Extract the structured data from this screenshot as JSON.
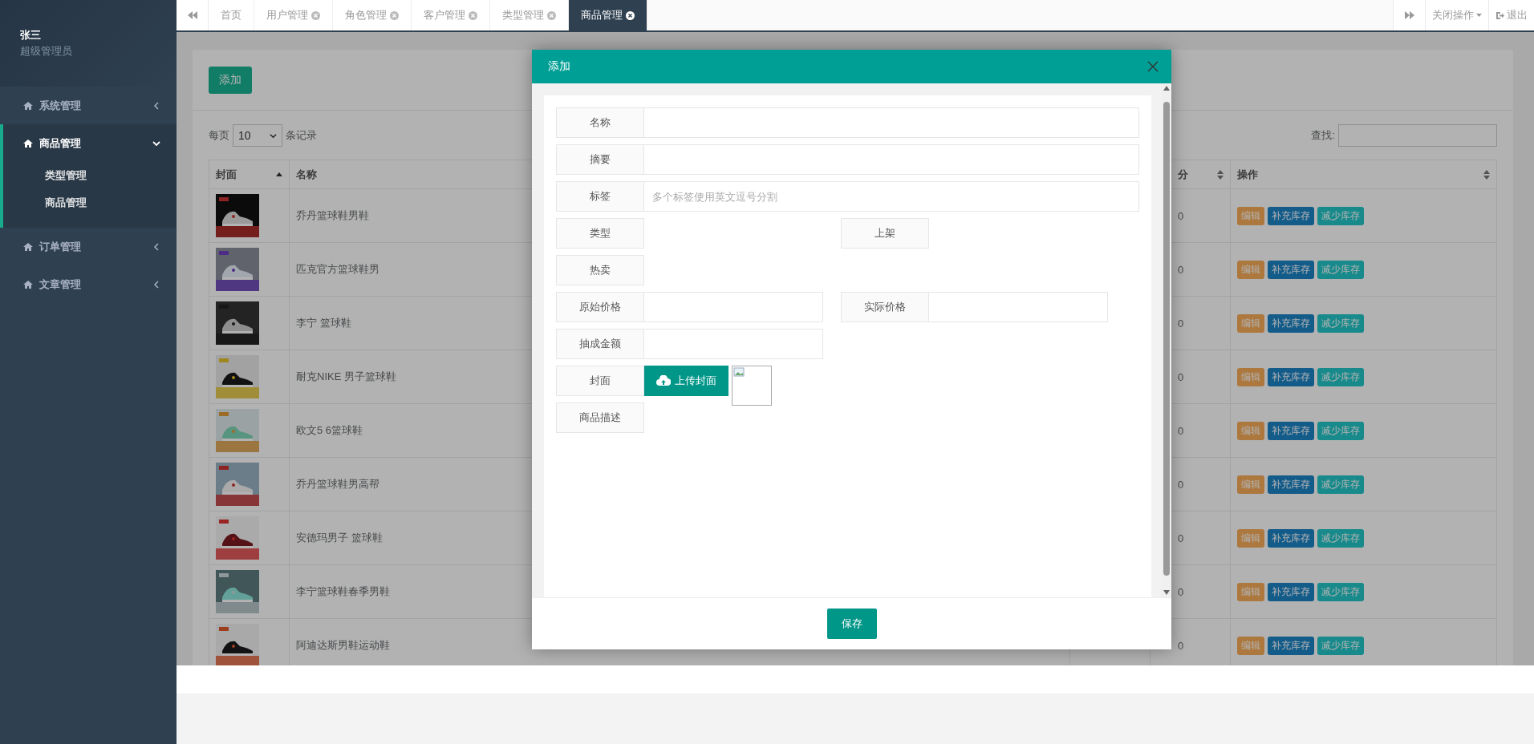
{
  "profile": {
    "name": "张三",
    "role": "超级管理员"
  },
  "sidebar": {
    "items": [
      {
        "label": "系统管理",
        "expanded": false
      },
      {
        "label": "商品管理",
        "expanded": true,
        "children": [
          {
            "label": "类型管理"
          },
          {
            "label": "商品管理"
          }
        ]
      },
      {
        "label": "订单管理",
        "expanded": false
      },
      {
        "label": "文章管理",
        "expanded": false
      }
    ]
  },
  "tabs": [
    {
      "label": "首页",
      "closable": false,
      "selected": false
    },
    {
      "label": "用户管理",
      "closable": true,
      "selected": false
    },
    {
      "label": "角色管理",
      "closable": true,
      "selected": false
    },
    {
      "label": "客户管理",
      "closable": true,
      "selected": false
    },
    {
      "label": "类型管理",
      "closable": true,
      "selected": false
    },
    {
      "label": "商品管理",
      "closable": true,
      "selected": true
    }
  ],
  "tab_actions": {
    "close_menu": "关闭操作",
    "logout": "退出"
  },
  "toolbar": {
    "add_button": "添加"
  },
  "table_controls": {
    "per_page_prefix": "每页",
    "per_page_value": "10",
    "per_page_suffix": "条记录",
    "search_label": "查找:"
  },
  "table": {
    "columns": [
      {
        "label": "封面",
        "kind": "sorted"
      },
      {
        "label": "名称",
        "kind": "plain"
      },
      {
        "label": "分",
        "kind": "sortable"
      },
      {
        "label": "操作",
        "kind": "sortable"
      }
    ],
    "rows": [
      {
        "cover": {
          "kind": "picture"
        },
        "name": "乔丹篮球鞋男鞋",
        "score": "0",
        "actions": [
          {
            "label": "编辑",
            "kind": "edit"
          },
          {
            "label": "补充库存",
            "kind": "add"
          },
          {
            "label": "减少库存",
            "kind": "reduce"
          }
        ]
      },
      {
        "cover": {
          "kind": "picture"
        },
        "name": "匹克官方篮球鞋男",
        "score": "0",
        "actions": [
          {
            "label": "编辑",
            "kind": "edit"
          },
          {
            "label": "补充库存",
            "kind": "add"
          },
          {
            "label": "减少库存",
            "kind": "reduce"
          }
        ]
      },
      {
        "cover": {
          "kind": "picture"
        },
        "name": "李宁 篮球鞋",
        "score": "0",
        "actions": [
          {
            "label": "编辑",
            "kind": "edit"
          },
          {
            "label": "补充库存",
            "kind": "add"
          },
          {
            "label": "减少库存",
            "kind": "reduce"
          }
        ]
      },
      {
        "cover": {
          "kind": "picture"
        },
        "name": "耐克NIKE 男子篮球鞋",
        "score": "0",
        "actions": [
          {
            "label": "编辑",
            "kind": "edit"
          },
          {
            "label": "补充库存",
            "kind": "add"
          },
          {
            "label": "减少库存",
            "kind": "reduce"
          }
        ]
      },
      {
        "cover": {
          "kind": "picture"
        },
        "name": "欧文5 6篮球鞋",
        "score": "0",
        "actions": [
          {
            "label": "编辑",
            "kind": "edit"
          },
          {
            "label": "补充库存",
            "kind": "add"
          },
          {
            "label": "减少库存",
            "kind": "reduce"
          }
        ]
      },
      {
        "cover": {
          "kind": "picture"
        },
        "name": "乔丹篮球鞋男高帮",
        "score": "0",
        "actions": [
          {
            "label": "编辑",
            "kind": "edit"
          },
          {
            "label": "补充库存",
            "kind": "add"
          },
          {
            "label": "减少库存",
            "kind": "reduce"
          }
        ]
      },
      {
        "cover": {
          "kind": "picture"
        },
        "name": "安德玛男子 篮球鞋",
        "score": "0",
        "actions": [
          {
            "label": "编辑",
            "kind": "edit"
          },
          {
            "label": "补充库存",
            "kind": "add"
          },
          {
            "label": "减少库存",
            "kind": "reduce"
          }
        ]
      },
      {
        "cover": {
          "kind": "picture"
        },
        "name": "李宁篮球鞋春季男鞋",
        "score": "0",
        "actions": [
          {
            "label": "编辑",
            "kind": "edit"
          },
          {
            "label": "补充库存",
            "kind": "add"
          },
          {
            "label": "减少库存",
            "kind": "reduce"
          }
        ]
      },
      {
        "cover": {
          "kind": "picture"
        },
        "name": "阿迪达斯男鞋运动鞋",
        "score": "0",
        "actions": [
          {
            "label": "编辑",
            "kind": "edit"
          },
          {
            "label": "补充库存",
            "kind": "add"
          },
          {
            "label": "减少库存",
            "kind": "reduce"
          }
        ]
      }
    ]
  },
  "modal": {
    "title": "添加",
    "rows": [
      [
        {
          "label": "名称",
          "kind": "wide"
        }
      ],
      [
        {
          "label": "摘要",
          "kind": "wide"
        }
      ],
      [
        {
          "label": "标签",
          "kind": "wide",
          "placeholder": "多个标签使用英文逗号分割"
        }
      ],
      [
        {
          "label": "类型",
          "kind": "blank"
        },
        {
          "label": "上架",
          "kind": "blank"
        }
      ],
      [
        {
          "label": "热卖",
          "kind": "blank"
        }
      ],
      [
        {
          "label": "原始价格",
          "kind": "input"
        },
        {
          "label": "实际价格",
          "kind": "input"
        }
      ],
      [
        {
          "label": "抽成金额",
          "kind": "input"
        }
      ],
      [
        {
          "label": "封面",
          "kind": "upload",
          "button": "上传封面"
        }
      ],
      [
        {
          "label": "商品描述",
          "kind": "blank"
        }
      ]
    ],
    "save_button": "保存"
  }
}
